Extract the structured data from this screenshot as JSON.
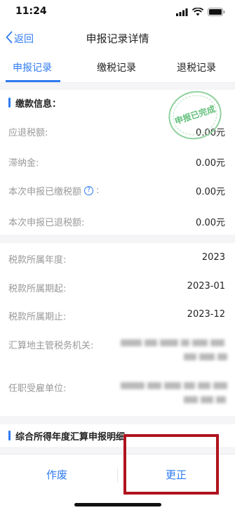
{
  "status": {
    "time": "11:24"
  },
  "navbar": {
    "back_label": "返回",
    "title": "申报记录详情"
  },
  "tabs": [
    {
      "label": "申报记录",
      "active": true
    },
    {
      "label": "缴税记录",
      "active": false
    },
    {
      "label": "退税记录",
      "active": false
    }
  ],
  "payment_section": {
    "title": "缴款信息：",
    "stamp_text": "申报已完成",
    "rows": [
      {
        "label": "应退税额:",
        "value": "0.00元"
      },
      {
        "label": "滞纳金:",
        "value": "0.00元"
      },
      {
        "label": "本次申报已缴税额",
        "label_suffix": ":",
        "value": "0.00元",
        "help": "?"
      },
      {
        "label": "本次申报已退税额:",
        "value": "0.00元"
      }
    ]
  },
  "tax_info": {
    "rows": [
      {
        "label": "税款所属年度:",
        "value": "2023"
      },
      {
        "label": "税款所属期起:",
        "value": "2023-01"
      },
      {
        "label": "税款所属期止:",
        "value": "2023-12"
      },
      {
        "label": "汇算地主管税务机关:",
        "value_redacted": true
      },
      {
        "label": "任职受雇单位:",
        "value_redacted": true
      }
    ]
  },
  "detail_section": {
    "title": "综合所得年度汇算申报明细"
  },
  "bottom": {
    "void_label": "作废",
    "correct_label": "更正"
  },
  "colors": {
    "accent": "#2f7bf1",
    "highlight": "#b0131d",
    "stamp": "#62c07a"
  },
  "icons": [
    "back-chevron-icon",
    "signal-icon",
    "wifi-icon",
    "battery-icon",
    "help-icon"
  ]
}
